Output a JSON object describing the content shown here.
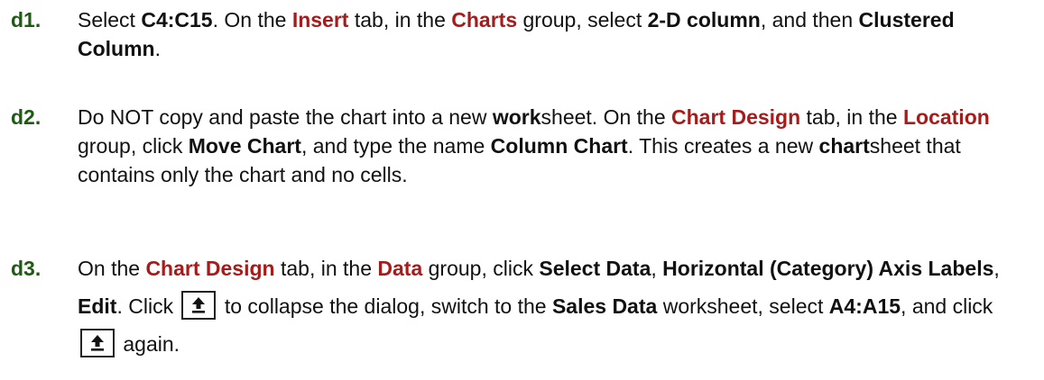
{
  "steps": [
    {
      "number": "d1.",
      "parts": [
        {
          "t": "Select ",
          "s": "n"
        },
        {
          "t": "C4:C15",
          "s": "b"
        },
        {
          "t": ". On the ",
          "s": "n"
        },
        {
          "t": "Insert",
          "s": "r"
        },
        {
          "t": " tab, in the ",
          "s": "n"
        },
        {
          "t": "Charts",
          "s": "r"
        },
        {
          "t": " group, select ",
          "s": "n"
        },
        {
          "t": "2-D column",
          "s": "b"
        },
        {
          "t": ", and then ",
          "s": "n"
        },
        {
          "t": "Clustered Column",
          "s": "b"
        },
        {
          "t": ".",
          "s": "n"
        }
      ]
    },
    {
      "number": "d2.",
      "parts": [
        {
          "t": "Do NOT copy and paste the chart into a new ",
          "s": "n"
        },
        {
          "t": "work",
          "s": "b"
        },
        {
          "t": "sheet. On the ",
          "s": "n"
        },
        {
          "t": "Chart Design",
          "s": "r"
        },
        {
          "t": " tab, in the ",
          "s": "n"
        },
        {
          "t": "Location",
          "s": "r"
        },
        {
          "t": " group, click ",
          "s": "n"
        },
        {
          "t": "Move Chart",
          "s": "b"
        },
        {
          "t": ", and type the name ",
          "s": "n"
        },
        {
          "t": "Column Chart",
          "s": "b"
        },
        {
          "t": ". This creates a new ",
          "s": "n"
        },
        {
          "t": "chart",
          "s": "b"
        },
        {
          "t": "sheet that contains only the chart and no cells.",
          "s": "n"
        }
      ]
    },
    {
      "number": "d3.",
      "parts": [
        {
          "t": "On the ",
          "s": "n"
        },
        {
          "t": "Chart Design",
          "s": "r"
        },
        {
          "t": " tab, in the ",
          "s": "n"
        },
        {
          "t": "Data",
          "s": "r"
        },
        {
          "t": " group, click ",
          "s": "n"
        },
        {
          "t": "Select Data",
          "s": "b"
        },
        {
          "t": ", ",
          "s": "n"
        },
        {
          "t": "Horizontal (Category) Axis Labels",
          "s": "b"
        },
        {
          "t": ", ",
          "s": "n"
        },
        {
          "t": "Edit",
          "s": "b"
        },
        {
          "t": ". Click ",
          "s": "n"
        },
        {
          "icon": "collapse-dialog-icon"
        },
        {
          "t": " to collapse the dialog, switch to the ",
          "s": "n"
        },
        {
          "t": "Sales Data",
          "s": "b"
        },
        {
          "t": " worksheet, select ",
          "s": "n"
        },
        {
          "t": "A4:A15",
          "s": "b"
        },
        {
          "t": ", and click ",
          "s": "n"
        },
        {
          "icon": "collapse-dialog-icon"
        },
        {
          "t": " again.",
          "s": "n"
        }
      ]
    }
  ],
  "colors": {
    "step_number": "#1f5a12",
    "ui_term": "#a51c1c",
    "text": "#111111"
  }
}
